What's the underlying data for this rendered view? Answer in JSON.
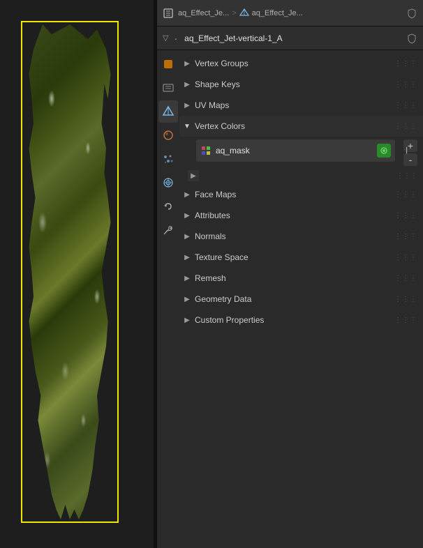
{
  "header": {
    "breadcrumb1": "aq_Effect_Je...",
    "breadcrumb2": "aq_Effect_Je...",
    "sep": ">"
  },
  "object": {
    "name": "aq_Effect_Jet-vertical-1_A",
    "prefix": "▽ ·"
  },
  "properties": {
    "sections": [
      {
        "id": "vertex-groups",
        "label": "Vertex Groups",
        "expanded": false
      },
      {
        "id": "shape-keys",
        "label": "Shape Keys",
        "expanded": false
      },
      {
        "id": "uv-maps",
        "label": "UV Maps",
        "expanded": false
      },
      {
        "id": "vertex-colors",
        "label": "Vertex Colors",
        "expanded": true
      },
      {
        "id": "face-maps",
        "label": "Face Maps",
        "expanded": false
      },
      {
        "id": "attributes",
        "label": "Attributes",
        "expanded": false
      },
      {
        "id": "normals",
        "label": "Normals",
        "expanded": false
      },
      {
        "id": "texture-space",
        "label": "Texture Space",
        "expanded": false
      },
      {
        "id": "remesh",
        "label": "Remesh",
        "expanded": false
      },
      {
        "id": "geometry-data",
        "label": "Geometry Data",
        "expanded": false
      },
      {
        "id": "custom-properties",
        "label": "Custom Properties",
        "expanded": false
      }
    ],
    "vertex_color_item": {
      "name": "aq_mask",
      "icon": "color-attr-icon"
    }
  },
  "buttons": {
    "add": "+",
    "remove": "-"
  },
  "icons": {
    "properties": "◈",
    "object_constraint": "⛓",
    "object_data": "⬡",
    "material": "●",
    "particles": "✦",
    "physics": "⚙",
    "chevron_right": "▶",
    "chevron_down": "▼",
    "dots": "⋮⋮⋮"
  }
}
